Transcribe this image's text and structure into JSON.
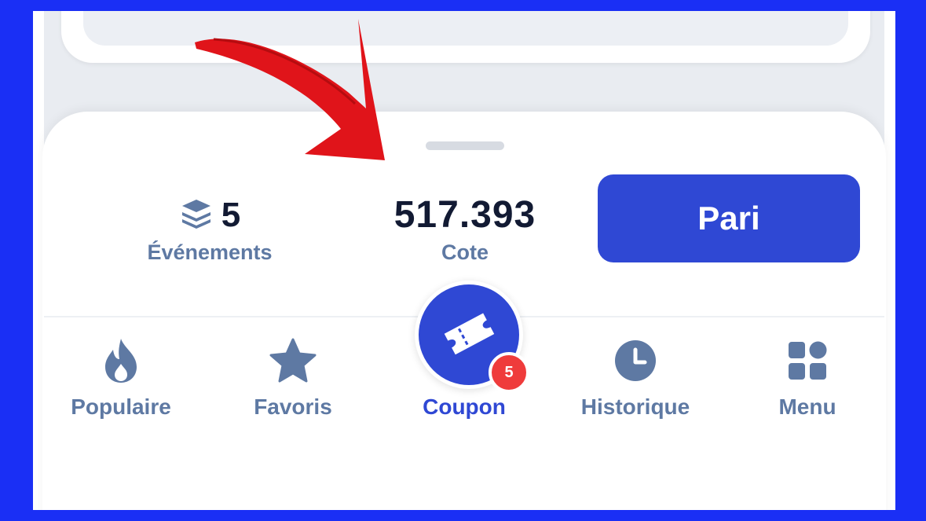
{
  "stats": {
    "events_count": "5",
    "events_label": "Événements",
    "odds_value": "517.393",
    "odds_label": "Cote"
  },
  "bet_button": {
    "label": "Pari"
  },
  "nav": {
    "items": [
      {
        "label": "Populaire",
        "icon": "flame-icon"
      },
      {
        "label": "Favoris",
        "icon": "star-icon"
      },
      {
        "label": "Coupon",
        "icon": "ticket-icon",
        "badge": "5",
        "active": true
      },
      {
        "label": "Historique",
        "icon": "clock-icon"
      },
      {
        "label": "Menu",
        "icon": "grid-icon"
      }
    ]
  },
  "colors": {
    "frame_border": "#1a2ff5",
    "accent": "#2f48d4",
    "icon_muted": "#5e79a3",
    "badge": "#ef3b3b",
    "annotation_arrow": "#e0141a"
  }
}
